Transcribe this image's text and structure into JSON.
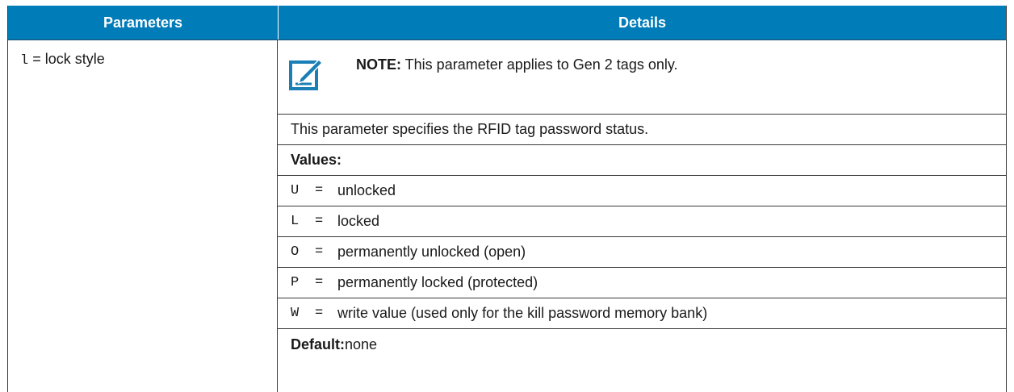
{
  "table": {
    "headers": [
      "Parameters",
      "Details"
    ],
    "row": {
      "param_code": "l",
      "param_label": " = lock style",
      "note_label": "NOTE:",
      "note_text": " This parameter applies to Gen 2 tags only.",
      "description": "This parameter specifies the RFID tag password status.",
      "values_heading": "Values:",
      "values": [
        {
          "code": "U",
          "eq": "=",
          "desc": "unlocked"
        },
        {
          "code": "L",
          "eq": "=",
          "desc": "locked"
        },
        {
          "code": "O",
          "eq": "=",
          "desc": "permanently unlocked (open)"
        },
        {
          "code": "P",
          "eq": "=",
          "desc": "permanently locked (protected)"
        },
        {
          "code": "W",
          "eq": "=",
          "desc": "write value (used only for the kill password memory bank)"
        }
      ],
      "default_label": "Default:",
      "default_value": " none"
    }
  },
  "colors": {
    "header_bg": "#007cb9",
    "note_icon": "#1a7fb5"
  },
  "icons": {
    "note": "note-pencil-icon"
  }
}
